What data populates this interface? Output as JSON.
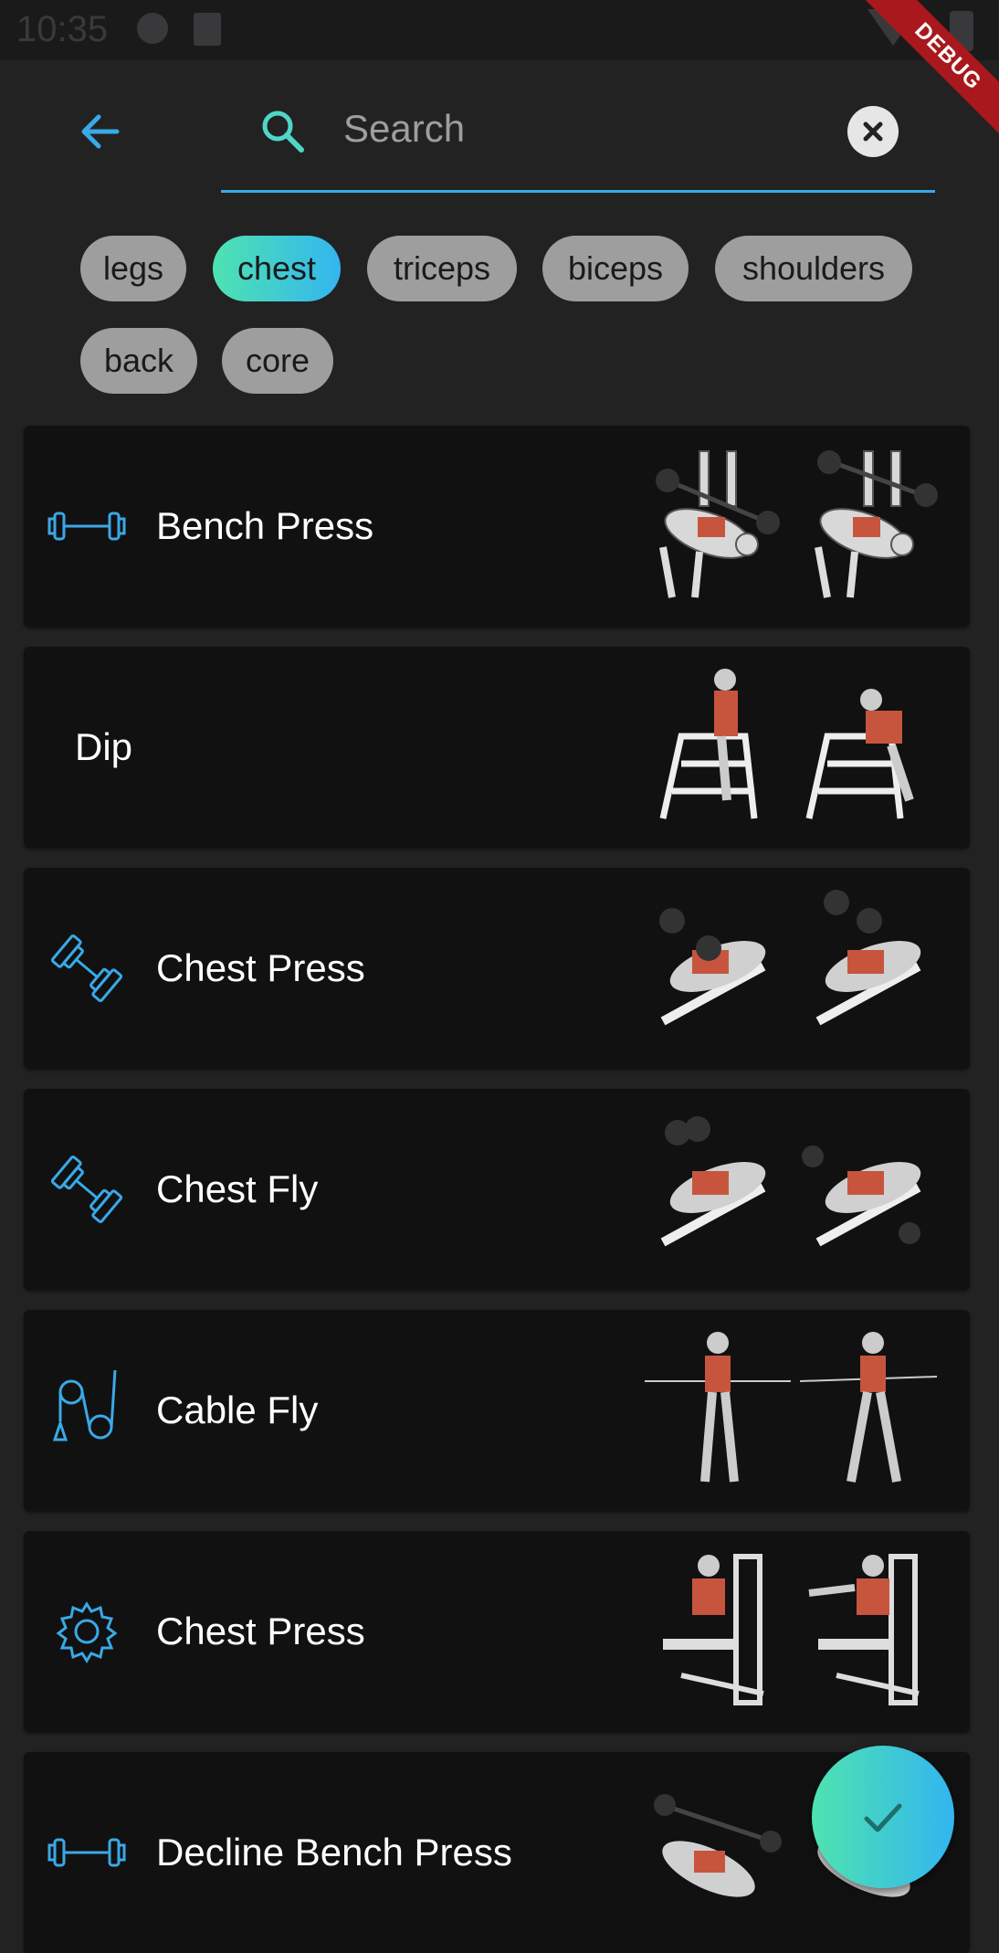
{
  "status_bar": {
    "time": "10:35"
  },
  "debug_banner": "DEBUG",
  "search": {
    "placeholder": "Search",
    "value": ""
  },
  "filters": [
    {
      "label": "legs",
      "selected": false
    },
    {
      "label": "chest",
      "selected": true
    },
    {
      "label": "triceps",
      "selected": false
    },
    {
      "label": "biceps",
      "selected": false
    },
    {
      "label": "shoulders",
      "selected": false
    },
    {
      "label": "back",
      "selected": false
    },
    {
      "label": "core",
      "selected": false
    }
  ],
  "exercises": [
    {
      "name": "Bench Press",
      "icon": "barbell-icon"
    },
    {
      "name": "Dip",
      "icon": ""
    },
    {
      "name": "Chest Press",
      "icon": "dumbbell-icon"
    },
    {
      "name": "Chest Fly",
      "icon": "dumbbell-icon"
    },
    {
      "name": "Cable Fly",
      "icon": "cable-pulley-icon"
    },
    {
      "name": "Chest Press",
      "icon": "machine-gear-icon"
    },
    {
      "name": "Decline Bench Press",
      "icon": "barbell-icon"
    }
  ],
  "colors": {
    "accent": "#3aa9e6",
    "gradient_start": "#4fe3b0",
    "gradient_end": "#33b5f0",
    "chip": "#9e9e9e",
    "card": "#111112",
    "background": "#222223"
  }
}
